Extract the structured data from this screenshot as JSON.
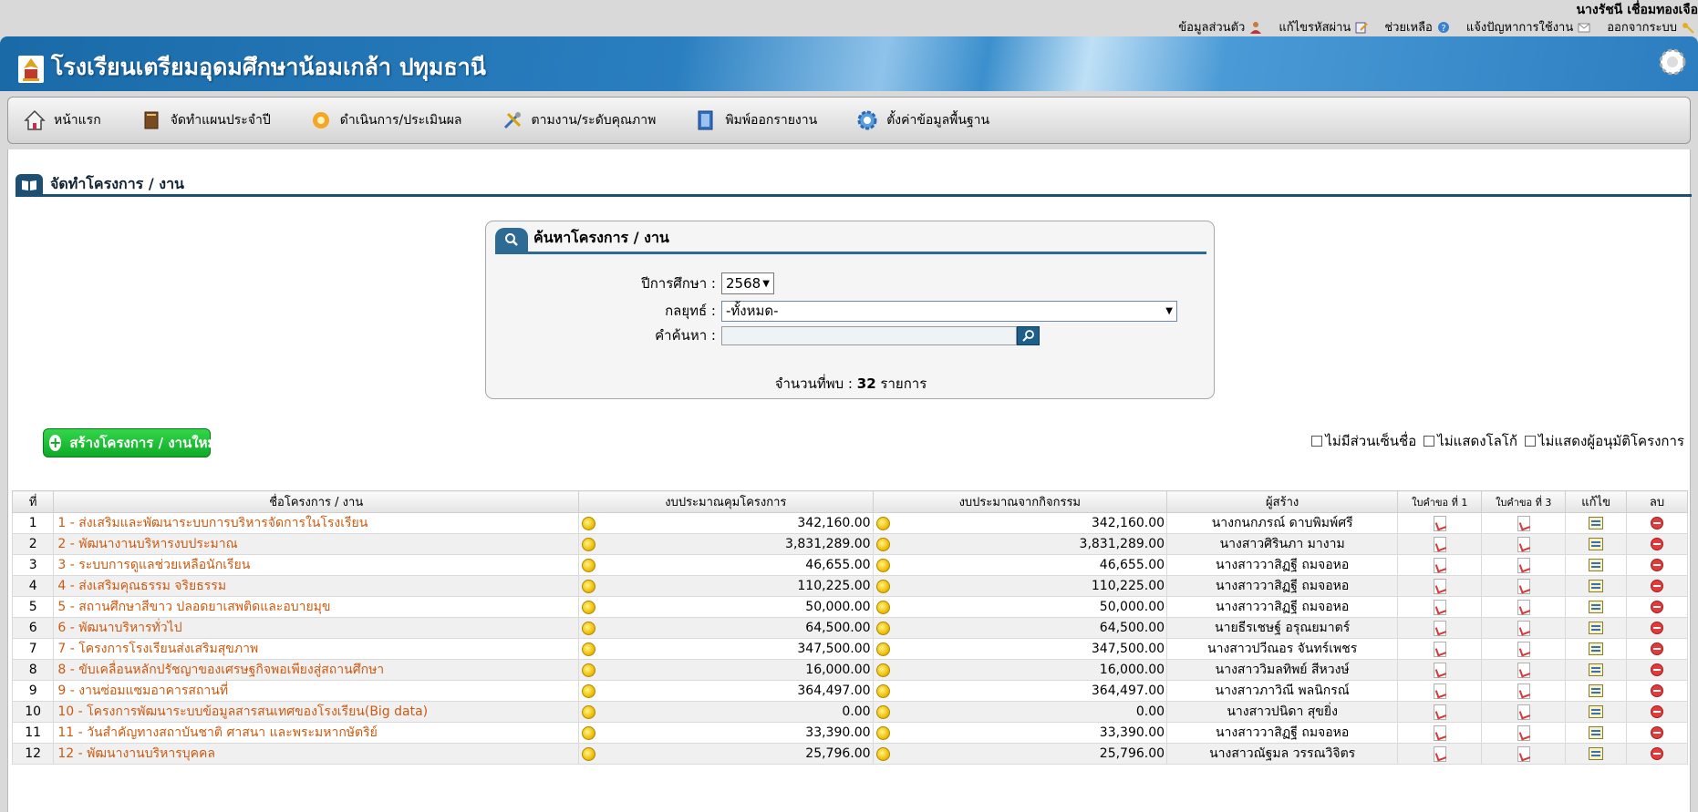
{
  "user": {
    "name": "นางรัชนี เชื่อมทองเจือ"
  },
  "top_links": [
    {
      "label": "ข้อมูลส่วนตัว",
      "icon": "user-icon"
    },
    {
      "label": "แก้ไขรหัสผ่าน",
      "icon": "edit-password-icon"
    },
    {
      "label": "ช่วยเหลือ",
      "icon": "help-icon"
    },
    {
      "label": "แจ้งปัญหาการใช้งาน",
      "icon": "mail-icon"
    },
    {
      "label": "ออกจากระบบ",
      "icon": "key-icon"
    }
  ],
  "banner": {
    "title": "โรงเรียนเตรียมอุดมศึกษาน้อมเกล้า ปทุมธานี"
  },
  "menu": [
    {
      "label": "หน้าแรก",
      "icon": "home-icon"
    },
    {
      "label": "จัดทำแผนประจำปี",
      "icon": "book-icon"
    },
    {
      "label": "ดำเนินการ/ประเมินผล",
      "icon": "gear-star-icon"
    },
    {
      "label": "ตามงาน/ระดับคุณภาพ",
      "icon": "tools-icon"
    },
    {
      "label": "พิมพ์ออกรายงาน",
      "icon": "document-icon"
    },
    {
      "label": "ตั้งค่าข้อมูลพื้นฐาน",
      "icon": "settings-icon"
    }
  ],
  "section": {
    "title": "จัดทำโครงการ / งาน"
  },
  "search": {
    "title": "ค้นหาโครงการ / งาน",
    "year_label": "ปีการศึกษา :",
    "year_value": "2568",
    "strategy_label": "กลยุทธ์ :",
    "strategy_value": "-ทั้งหมด-",
    "keyword_label": "คำค้นหา :",
    "keyword_value": "",
    "found_prefix": "จำนวนที่พบ :",
    "found_count": "32",
    "found_suffix": "รายการ"
  },
  "create_button": {
    "label": "สร้างโครงการ / งานใหม่"
  },
  "options": [
    {
      "label": "ไม่มีส่วนเซ็นชื่อ",
      "checked": false
    },
    {
      "label": "ไม่แสดงโลโก้",
      "checked": false
    },
    {
      "label": "ไม่แสดงผู้อนุมัติโครงการ",
      "checked": false
    }
  ],
  "table": {
    "headers": [
      "ที่",
      "ชื่อโครงการ / งาน",
      "งบประมาณคุมโครงการ",
      "งบประมาณจากกิจกรรม",
      "ผู้สร้าง",
      "ใบคำขอ ที่ 1",
      "ใบคำขอ ที่ 3",
      "แก้ไข",
      "ลบ"
    ],
    "rows": [
      {
        "no": "1",
        "name": "1 - ส่งเสริมและพัฒนาระบบการบริหารจัดการในโรงเรียน",
        "budget": "342,160.00",
        "activity": "342,160.00",
        "creator": "นางกนกภรณ์ ดาบพิมพ์ศรี"
      },
      {
        "no": "2",
        "name": "2 - พัฒนางานบริหารงบประมาณ",
        "budget": "3,831,289.00",
        "activity": "3,831,289.00",
        "creator": "นางสาวศิรินภา มางาม"
      },
      {
        "no": "3",
        "name": "3 - ระบบการดูแลช่วยเหลือนักเรียน",
        "budget": "46,655.00",
        "activity": "46,655.00",
        "creator": "นางสาววาสิฏฐี ถมจอหอ"
      },
      {
        "no": "4",
        "name": "4 - ส่งเสริมคุณธรรม จริยธรรม",
        "budget": "110,225.00",
        "activity": "110,225.00",
        "creator": "นางสาววาสิฏฐี ถมจอหอ"
      },
      {
        "no": "5",
        "name": "5 - สถานศึกษาสีขาว ปลอดยาเสพติดและอบายมุข",
        "budget": "50,000.00",
        "activity": "50,000.00",
        "creator": "นางสาววาสิฏฐี ถมจอหอ"
      },
      {
        "no": "6",
        "name": "6 - พัฒนาบริหารทั่วไป",
        "budget": "64,500.00",
        "activity": "64,500.00",
        "creator": "นายธีรเชษฐ์ อรุณยมาตร์"
      },
      {
        "no": "7",
        "name": "7 - โครงการโรงเรียนส่งเสริมสุขภาพ",
        "budget": "347,500.00",
        "activity": "347,500.00",
        "creator": "นางสาวปวีณอร จันทร์เพชร"
      },
      {
        "no": "8",
        "name": "8 - ขับเคลื่อนหลักปรัชญาของเศรษฐกิจพอเพียงสู่สถานศึกษา",
        "budget": "16,000.00",
        "activity": "16,000.00",
        "creator": "นางสาววิมลทิพย์ สีหวงษ์"
      },
      {
        "no": "9",
        "name": "9 - งานซ่อมแซมอาคารสถานที่",
        "budget": "364,497.00",
        "activity": "364,497.00",
        "creator": "นางสาวภาวิณี พลนิกรณ์"
      },
      {
        "no": "10",
        "name": "10 - โครงการพัฒนาระบบข้อมูลสารสนเทศของโรงเรียน(Big data)",
        "budget": "0.00",
        "activity": "0.00",
        "creator": "นางสาวปนิดา สุขยิ่ง"
      },
      {
        "no": "11",
        "name": "11 - วันสำคัญทางสถาบันชาติ ศาสนา และพระมหากษัตริย์",
        "budget": "33,390.00",
        "activity": "33,390.00",
        "creator": "นางสาววาสิฏฐี ถมจอหอ"
      },
      {
        "no": "12",
        "name": "12 - พัฒนางานบริหารบุคคล",
        "budget": "25,796.00",
        "activity": "25,796.00",
        "creator": "นางสาวณัฐมล วรรณวิจิตร"
      }
    ]
  },
  "colors": {
    "accent": "#1d4f73",
    "link": "#cc5a10",
    "create_button": "#10a42a"
  }
}
